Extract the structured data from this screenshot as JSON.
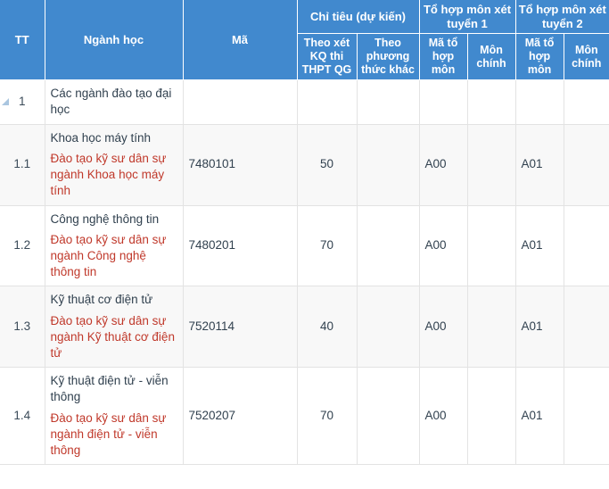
{
  "table": {
    "header": {
      "group_row": [
        {
          "label": "TT"
        },
        {
          "label": "Ngành học"
        },
        {
          "label": "Mã"
        },
        {
          "label": "Chỉ tiêu (dự kiến)"
        },
        {
          "label": "Tổ hợp môn xét tuyển 1"
        },
        {
          "label": "Tổ hợp môn xét tuyển 2"
        }
      ],
      "sub_row": [
        {
          "label": "Theo xét KQ thi THPT QG"
        },
        {
          "label": "Theo phương thức khác"
        },
        {
          "label": "Mã tổ hợp môn"
        },
        {
          "label": "Môn chính"
        },
        {
          "label": "Mã tổ hợp môn"
        },
        {
          "label": "Môn chính"
        }
      ]
    },
    "rows": [
      {
        "tt": "1",
        "has_collapse_icon": true,
        "name_main": "Các ngành đào tạo đại học",
        "name_sub": "",
        "ma": "",
        "chi_tieu_thpt": "",
        "chi_tieu_khac": "",
        "ma_to_hop_1": "",
        "mon_chinh_1": "",
        "ma_to_hop_2": "",
        "mon_chinh_2": ""
      },
      {
        "tt": "1.1",
        "has_collapse_icon": false,
        "name_main": "Khoa học máy tính",
        "name_sub": "Đào tạo kỹ sư dân sự ngành Khoa học máy tính",
        "ma": "7480101",
        "chi_tieu_thpt": "50",
        "chi_tieu_khac": "",
        "ma_to_hop_1": "A00",
        "mon_chinh_1": "",
        "ma_to_hop_2": "A01",
        "mon_chinh_2": ""
      },
      {
        "tt": "1.2",
        "has_collapse_icon": false,
        "name_main": "Công nghệ thông tin",
        "name_sub": "Đào tạo kỹ sư dân sự ngành Công nghệ thông tin",
        "ma": "7480201",
        "chi_tieu_thpt": "70",
        "chi_tieu_khac": "",
        "ma_to_hop_1": "A00",
        "mon_chinh_1": "",
        "ma_to_hop_2": "A01",
        "mon_chinh_2": ""
      },
      {
        "tt": "1.3",
        "has_collapse_icon": false,
        "name_main": "Kỹ thuật cơ điện tử",
        "name_sub": "Đào tạo kỹ sư dân sự ngành Kỹ thuật cơ điện tử",
        "ma": "7520114",
        "chi_tieu_thpt": "40",
        "chi_tieu_khac": "",
        "ma_to_hop_1": "A00",
        "mon_chinh_1": "",
        "ma_to_hop_2": "A01",
        "mon_chinh_2": ""
      },
      {
        "tt": "1.4",
        "has_collapse_icon": false,
        "name_main": "Kỹ thuật điện tử - viễn thông",
        "name_sub": "Đào tạo kỹ sư dân sự ngành điện tử - viễn thông",
        "ma": "7520207",
        "chi_tieu_thpt": "70",
        "chi_tieu_khac": "",
        "ma_to_hop_1": "A00",
        "mon_chinh_1": "",
        "ma_to_hop_2": "A01",
        "mon_chinh_2": ""
      }
    ]
  },
  "colors": {
    "header_background": "#4189ce",
    "header_text": "#ffffff",
    "body_text": "#31414f",
    "sub_text_red": "#c0392b",
    "row_alt_background": "#f8f8f8",
    "grid_border": "#e3e3e3",
    "collapse_icon": "#aac6e0"
  }
}
